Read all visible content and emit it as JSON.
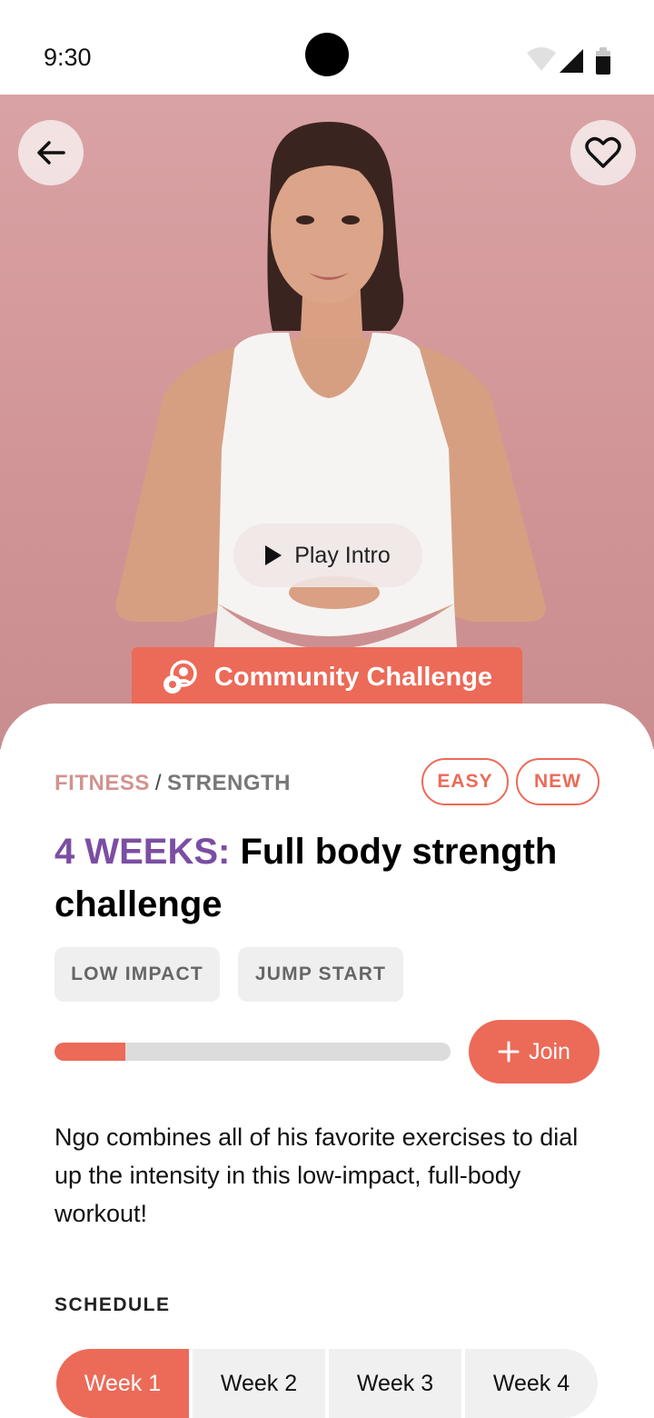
{
  "status_bar": {
    "time": "9:30"
  },
  "hero": {
    "play_label": "Play Intro",
    "community_label": "Community Challenge",
    "icons": {
      "back": "arrow-left-icon",
      "favorite": "heart-outline-icon",
      "play": "play-icon",
      "community": "community-icon"
    }
  },
  "breadcrumb": {
    "category": "FITNESS",
    "separator": "/",
    "subcategory": "STRENGTH"
  },
  "tags": {
    "difficulty": "EASY",
    "status": "NEW"
  },
  "title": {
    "accent": "4 WEEKS:",
    "main": "Full body strength challenge"
  },
  "chips": [
    "LOW IMPACT",
    "JUMP START"
  ],
  "progress": {
    "percent": 18
  },
  "join": {
    "label": "Join",
    "icon": "plus-icon"
  },
  "description": "Ngo combines all of his favorite exercises to dial up the intensity in this low-impact, full-body workout!",
  "schedule": {
    "label": "SCHEDULE",
    "weeks": [
      "Week 1",
      "Week 2",
      "Week 3",
      "Week 4"
    ],
    "active_index": 0
  },
  "colors": {
    "accent": "#ec6a58",
    "purple": "#7b4ea3",
    "hero_bg": "#d49a9c",
    "crumb": "#d19390"
  }
}
